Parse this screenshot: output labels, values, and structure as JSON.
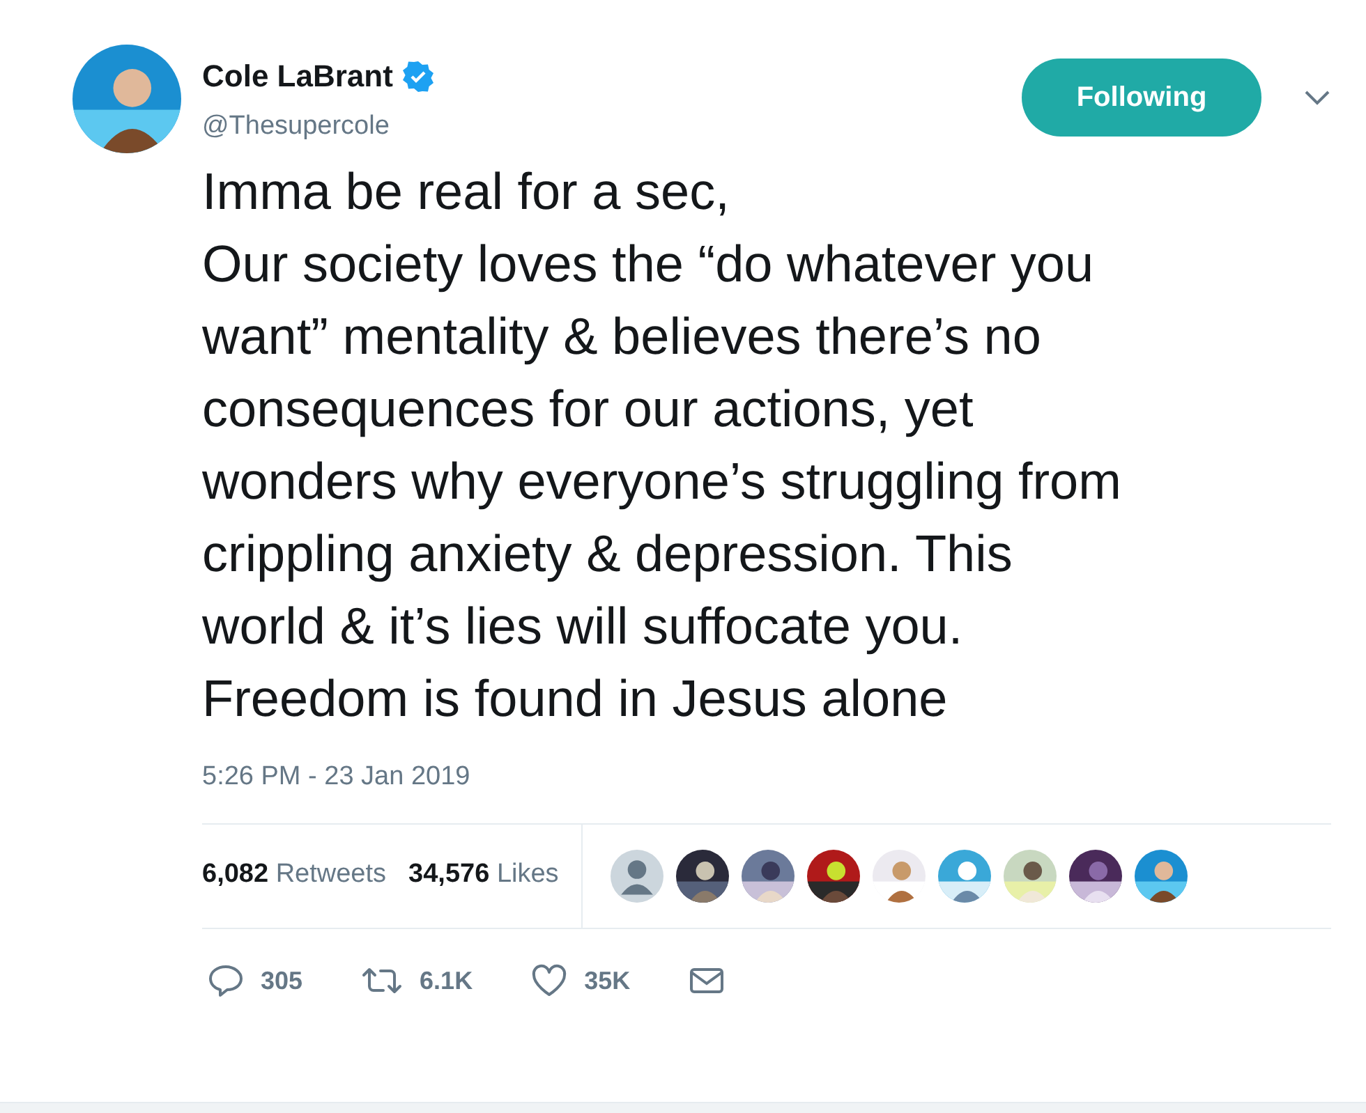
{
  "author": {
    "name": "Cole LaBrant",
    "verified": true,
    "handle": "@Thesupercole"
  },
  "follow_button": {
    "label": "Following",
    "selected": true
  },
  "tweet_text": "Imma be real for a sec,\nOur society loves the “do whatever you\nwant” mentality & believes there’s no\nconsequences for our actions, yet\nwonders why everyone’s struggling from\ncrippling anxiety & depression. This\nworld & it’s lies will suffocate you.\nFreedom is found in Jesus alone",
  "timestamp": "5:26 PM - 23 Jan 2019",
  "stats": [
    {
      "count": "6,082",
      "label": "Retweets"
    },
    {
      "count": "34,576",
      "label": "Likes"
    }
  ],
  "liker_avatars": [
    {
      "kind": "default"
    },
    {
      "kind": "picture"
    },
    {
      "kind": "picture"
    },
    {
      "kind": "picture"
    },
    {
      "kind": "picture"
    },
    {
      "kind": "picture"
    },
    {
      "kind": "picture"
    },
    {
      "kind": "picture"
    },
    {
      "kind": "picture"
    }
  ],
  "actions": [
    {
      "kind": "reply",
      "count": "305"
    },
    {
      "kind": "retweet",
      "count": "6.1K"
    },
    {
      "kind": "like",
      "count": "35K"
    },
    {
      "kind": "message"
    }
  ]
}
